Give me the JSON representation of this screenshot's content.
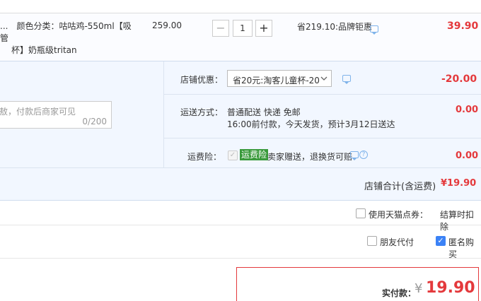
{
  "item": {
    "sku": "...　颜色分类：咕咕鸡-550ml【吸管",
    "sku_line2": "杯】奶瓶级tritan",
    "price": "259.00",
    "quantity": "1",
    "minus": "−",
    "plus": "+",
    "promo": "省219.10:品牌钜惠",
    "total": "39.90"
  },
  "shop": {
    "message_placeholder": "敖，付款后商家可见",
    "message_counter": "0/200",
    "discount_label": "店铺优惠：",
    "discount_value": "省20元:淘客儿童杯-20",
    "discount_amount": "-20.00",
    "delivery_label": "运送方式：",
    "delivery_line1": "普通配送 快递 免邮",
    "delivery_line2": "16:00前付款，今天发货，预计3月12日送达",
    "delivery_amount": "0.00",
    "insurance_label": "运费险：",
    "insurance_badge": "运费险",
    "insurance_desc": "卖家赠送，退换货可赔",
    "insurance_amount": "0.00",
    "subtotal_label": "店铺合计(含运费)",
    "subtotal_value": "¥19.90"
  },
  "options": {
    "tmall_points_label": "使用天猫点券：",
    "tmall_points_note": "结算时扣除",
    "friend_pay_label": "朋友代付",
    "anonymous_label": "匿名购买"
  },
  "payment": {
    "label": "实付款：",
    "currency": "¥",
    "amount": "19.90"
  },
  "colors": {
    "accent_red": "#e4393c",
    "shop_bg": "#f2f7ff",
    "badge_green": "#3a9a3c"
  }
}
